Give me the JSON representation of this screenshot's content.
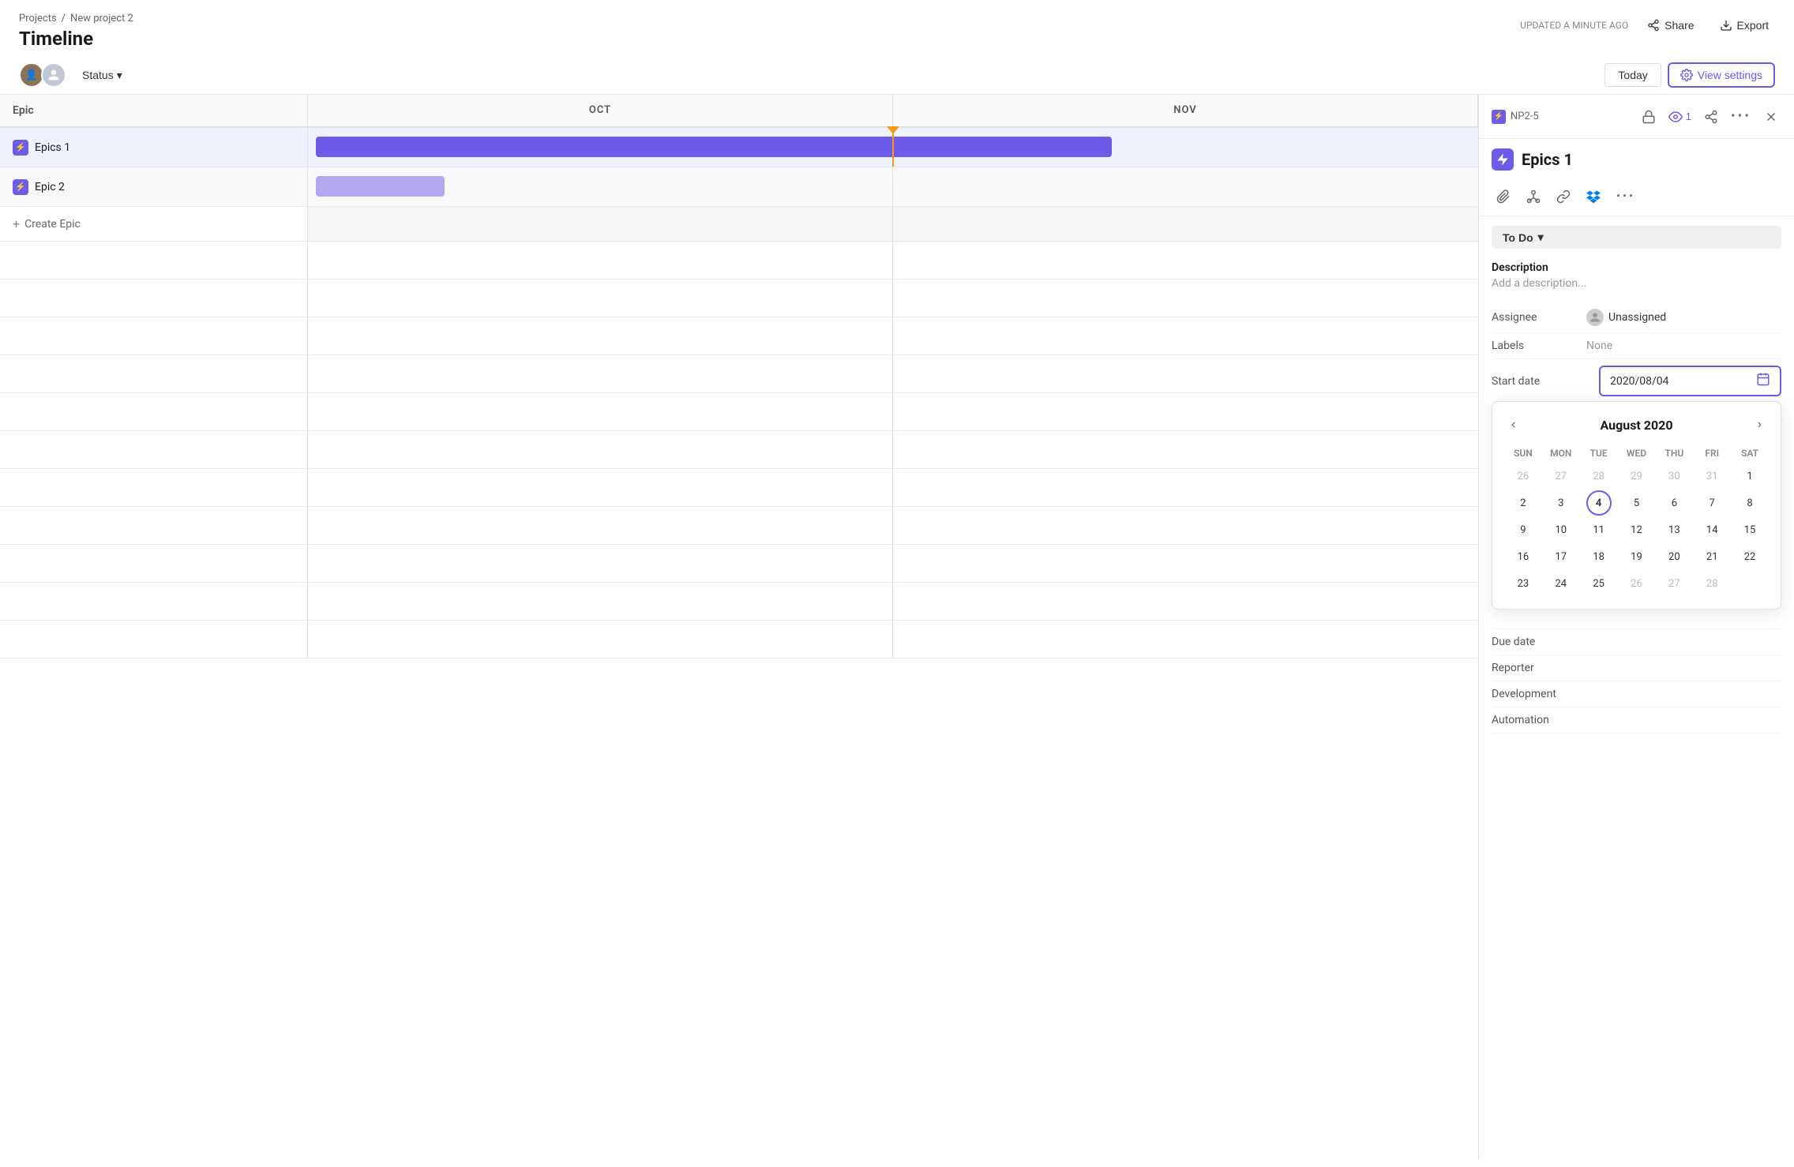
{
  "app": {
    "updated_text": "UPDATED A MINUTE AGO",
    "share_label": "Share",
    "export_label": "Export"
  },
  "breadcrumb": {
    "projects": "Projects",
    "separator": "/",
    "project_name": "New project 2"
  },
  "page": {
    "title": "Timeline"
  },
  "toolbar": {
    "status_label": "Status",
    "today_label": "Today",
    "view_settings_label": "View settings"
  },
  "timeline": {
    "epic_col_header": "Epic",
    "months": [
      "OCT",
      "NOV"
    ],
    "rows": [
      {
        "id": "epics1",
        "icon": "⚡",
        "name": "Epics 1",
        "highlighted": true
      },
      {
        "id": "epic2",
        "icon": "⚡",
        "name": "Epic 2",
        "highlighted": false
      }
    ],
    "create_label": "Create Epic"
  },
  "detail_panel": {
    "id": "NP2-5",
    "watch_count": "1",
    "title": "Epics 1",
    "status": {
      "label": "To Do",
      "dropdown_icon": "▾"
    },
    "description": {
      "label": "Description",
      "placeholder": "Add a description..."
    },
    "fields": {
      "assignee": {
        "label": "Assignee",
        "value": "Unassigned"
      },
      "labels": {
        "label": "Labels",
        "value": "None"
      },
      "start_date": {
        "label": "Start date",
        "value": "2020/08/04"
      },
      "due_date": {
        "label": "Due date"
      },
      "reporter": {
        "label": "Reporter"
      },
      "development": {
        "label": "Development"
      },
      "automation": {
        "label": "Automation"
      }
    },
    "calendar": {
      "month_title": "August 2020",
      "day_headers": [
        "SUN",
        "MON",
        "TUE",
        "WED",
        "THU",
        "FRI",
        "SAT"
      ],
      "weeks": [
        [
          "26",
          "27",
          "28",
          "29",
          "30",
          "31",
          "1"
        ],
        [
          "2",
          "3",
          "4",
          "5",
          "6",
          "7",
          "8"
        ],
        [
          "9",
          "10",
          "11",
          "12",
          "13",
          "14",
          "15"
        ],
        [
          "16",
          "17",
          "18",
          "19",
          "20",
          "21",
          "22"
        ],
        [
          "23",
          "24",
          "25",
          "26",
          "27",
          "28",
          ""
        ]
      ],
      "other_month_days": [
        "26",
        "27",
        "28",
        "29",
        "30",
        "31"
      ],
      "selected_day": "4",
      "last_row_other": [
        "26",
        "27",
        "28"
      ]
    }
  }
}
